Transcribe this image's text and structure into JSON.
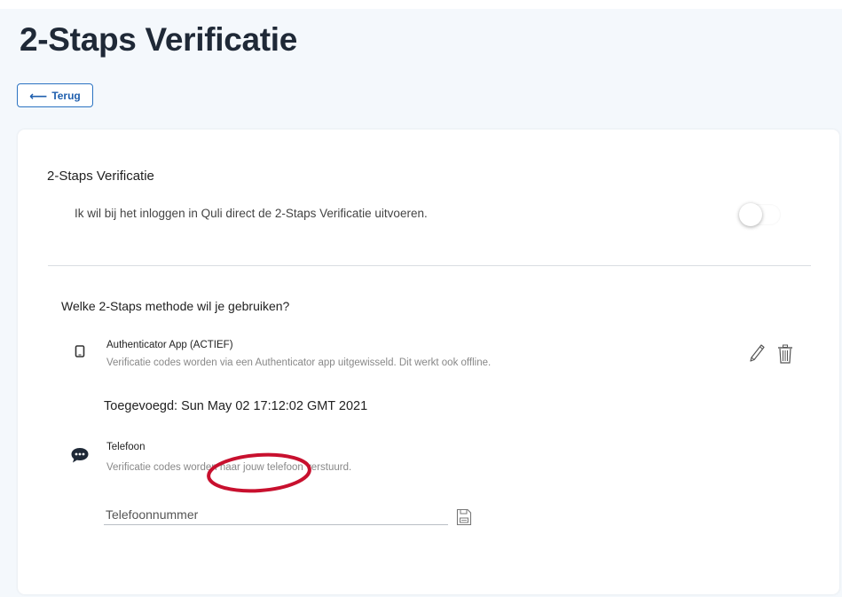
{
  "page": {
    "title": "2-Staps Verificatie",
    "back_label": "Terug",
    "back_icon": "arrow-left-icon"
  },
  "two_step": {
    "title": "2-Staps Verificatie",
    "description": "Ik wil bij het inloggen in Quli direct de 2-Staps Verificatie uitvoeren.",
    "enabled": false
  },
  "methods": {
    "question": "Welke 2-Staps methode wil je gebruiken?",
    "authenticator": {
      "icon": "phone-icon",
      "name": "Authenticator App (ACTIEF)",
      "description": "Verificatie codes worden via een Authenticator app uitgewisseld. Dit werkt ook offline.",
      "added": "Toegevoegd: Sun May 02 17:12:02 GMT 2021",
      "edit_icon": "pencil-icon",
      "delete_icon": "trash-icon"
    },
    "phone": {
      "icon": "chat-bubble-icon",
      "name": "Telefoon",
      "description": "Verificatie codes worden naar jouw telefoon verstuurd.",
      "input_placeholder": "Telefoonnummer",
      "input_value": "",
      "save_icon": "save-icon"
    }
  },
  "colors": {
    "accent": "#2b73c2",
    "annotation": "#c8102e",
    "background": "#f4f8fc"
  }
}
